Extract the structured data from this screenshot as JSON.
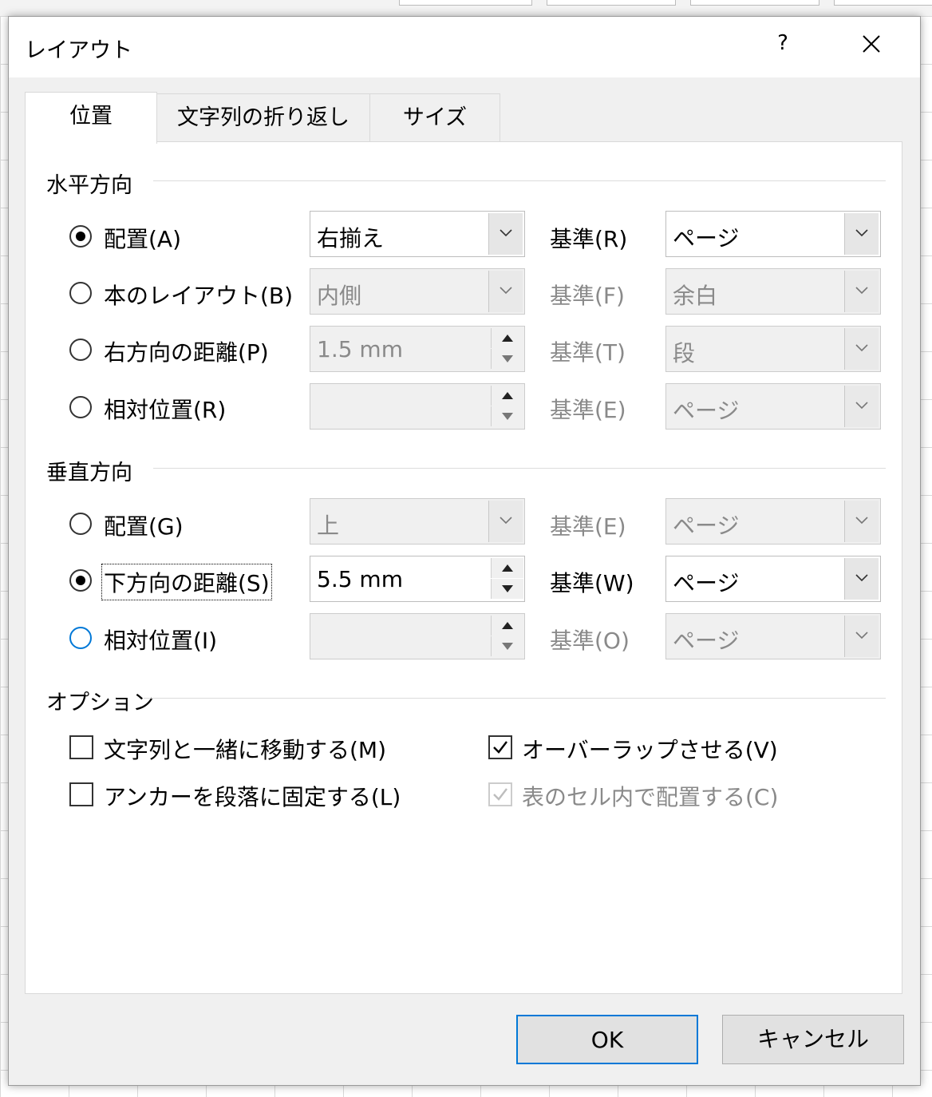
{
  "dialog": {
    "title": "レイアウト",
    "help_label": "?",
    "close_label": "✕"
  },
  "tabs": [
    {
      "label": "位置",
      "active": true
    },
    {
      "label": "文字列の折り返し",
      "active": false
    },
    {
      "label": "サイズ",
      "active": false
    }
  ],
  "horizontal": {
    "header": "水平方向",
    "rows": [
      {
        "label": "配置(A)",
        "checked": true,
        "value": "右揃え",
        "kind": "combo",
        "enabled": true,
        "ref_label": "基準(R)",
        "ref_value": "ページ",
        "ref_enabled": true
      },
      {
        "label": "本のレイアウト(B)",
        "checked": false,
        "value": "内側",
        "kind": "combo",
        "enabled": false,
        "ref_label": "基準(F)",
        "ref_value": "余白",
        "ref_enabled": false
      },
      {
        "label": "右方向の距離(P)",
        "checked": false,
        "value": "1.5 mm",
        "kind": "spin",
        "enabled": false,
        "ref_label": "基準(T)",
        "ref_value": "段",
        "ref_enabled": false
      },
      {
        "label": "相対位置(R)",
        "checked": false,
        "value": "",
        "kind": "spin",
        "enabled": false,
        "ref_label": "基準(E)",
        "ref_value": "ページ",
        "ref_enabled": false
      }
    ]
  },
  "vertical": {
    "header": "垂直方向",
    "rows": [
      {
        "label": "配置(G)",
        "checked": false,
        "value": "上",
        "kind": "combo",
        "enabled": false,
        "ref_label": "基準(E)",
        "ref_value": "ページ",
        "ref_enabled": false
      },
      {
        "label": "下方向の距離(S)",
        "checked": true,
        "value": "5.5 mm",
        "kind": "spin",
        "enabled": true,
        "ref_label": "基準(W)",
        "ref_value": "ページ",
        "ref_enabled": true
      },
      {
        "label": "相対位置(I)",
        "checked": false,
        "value": "",
        "kind": "spin",
        "enabled": false,
        "ref_label": "基準(O)",
        "ref_value": "ページ",
        "ref_enabled": false
      }
    ]
  },
  "options": {
    "header": "オプション",
    "items": [
      {
        "label": "文字列と一緒に移動する(M)",
        "checked": false,
        "enabled": true
      },
      {
        "label": "アンカーを段落に固定する(L)",
        "checked": false,
        "enabled": true
      },
      {
        "label": "オーバーラップさせる(V)",
        "checked": true,
        "enabled": true
      },
      {
        "label": "表のセル内で配置する(C)",
        "checked": true,
        "enabled": false
      }
    ]
  },
  "buttons": {
    "ok": "OK",
    "cancel": "キャンセル"
  },
  "colors": {
    "accent": "#0078d7",
    "disabled_text": "#8a8a8a",
    "dialog_bg": "#f0f0f0"
  },
  "icons": {
    "dropdown": "chevron-down-icon",
    "spin_up": "spin-up-arrow-icon",
    "spin_down": "spin-down-arrow-icon",
    "checkmark": "checkmark-icon"
  }
}
